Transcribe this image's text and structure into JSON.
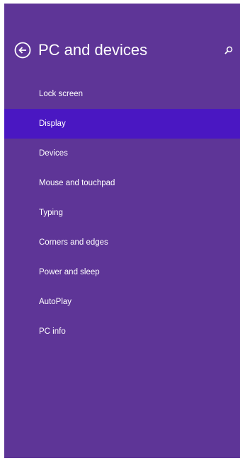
{
  "header": {
    "back_icon": "back-arrow-circle-icon",
    "title": "PC and devices",
    "search_icon": "search-icon"
  },
  "colors": {
    "panel_background": "#5e3597",
    "selected_background": "#4a17c2",
    "text": "#ffffff"
  },
  "nav": {
    "selected_index": 1,
    "items": [
      {
        "label": "Lock screen"
      },
      {
        "label": "Display"
      },
      {
        "label": "Devices"
      },
      {
        "label": "Mouse and touchpad"
      },
      {
        "label": "Typing"
      },
      {
        "label": "Corners and edges"
      },
      {
        "label": "Power and sleep"
      },
      {
        "label": "AutoPlay"
      },
      {
        "label": "PC info"
      }
    ]
  }
}
